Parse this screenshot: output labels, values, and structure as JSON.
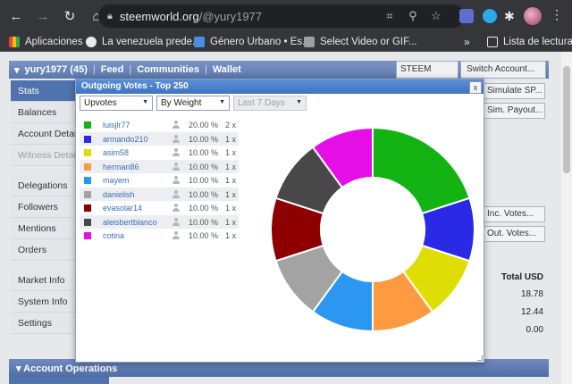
{
  "browser": {
    "url_host": "steemworld.org",
    "url_path": "/@yury1977",
    "bookmarks": [
      {
        "label": "Aplicaciones",
        "icon": "apps-grid-icon"
      },
      {
        "label": "La venezuela prede...",
        "icon": "globe-icon"
      },
      {
        "label": "Género Urbano • Es...",
        "icon": "download-icon"
      },
      {
        "label": "Select Video or GIF...",
        "icon": "video-icon"
      }
    ],
    "more_label": "»",
    "reading_list": "Lista de lectura"
  },
  "topbar": {
    "user": "yury1977 (45)",
    "links": [
      "Feed",
      "Communities",
      "Wallet"
    ],
    "separator": "|",
    "currency_select": "STEEM",
    "switch_account": "Switch Account..."
  },
  "sidebar": {
    "items": [
      {
        "label": "Stats",
        "state": "active"
      },
      {
        "label": "Balances",
        "state": "normal"
      },
      {
        "label": "Account Details",
        "state": "normal"
      },
      {
        "label": "Witness Details",
        "state": "disabled"
      },
      {
        "label": "Delegations",
        "state": "normal"
      },
      {
        "label": "Followers",
        "state": "normal"
      },
      {
        "label": "Mentions",
        "state": "normal"
      },
      {
        "label": "Orders",
        "state": "normal"
      },
      {
        "label": "Market Info",
        "state": "normal"
      },
      {
        "label": "System Info",
        "state": "normal"
      },
      {
        "label": "Settings",
        "state": "normal"
      }
    ]
  },
  "right_panel": {
    "simulate_sp": "Simulate SP...",
    "sim_payout": "Sim. Payout...",
    "inc_votes": "Inc. Votes...",
    "out_votes": "Out. Votes...",
    "total_usd_label": "Total USD",
    "values": [
      "18.78",
      "12.44",
      "0.00"
    ]
  },
  "account_operations": "Account Operations",
  "modal": {
    "title": "Outgoing Votes - Top 250",
    "close": "x",
    "filter_type": "Upvotes",
    "filter_sort": "By Weight",
    "filter_period": "Last 7 Days",
    "votes": [
      {
        "name": "luisjlr77",
        "pct": "20.00 %",
        "count": "2 x",
        "color": "#12b312"
      },
      {
        "name": "armando210",
        "pct": "10.00 %",
        "count": "1 x",
        "color": "#2a2ae6"
      },
      {
        "name": "asim58",
        "pct": "10.00 %",
        "count": "1 x",
        "color": "#dede05"
      },
      {
        "name": "herman86",
        "pct": "10.00 %",
        "count": "1 x",
        "color": "#ff9a40"
      },
      {
        "name": "mayem",
        "pct": "10.00 %",
        "count": "1 x",
        "color": "#2b97f1"
      },
      {
        "name": "danielish",
        "pct": "10.00 %",
        "count": "1 x",
        "color": "#a3a3a3"
      },
      {
        "name": "evasolar14",
        "pct": "10.00 %",
        "count": "1 x",
        "color": "#8e0000"
      },
      {
        "name": "aleisbertblanco",
        "pct": "10.00 %",
        "count": "1 x",
        "color": "#484848"
      },
      {
        "name": "cotina",
        "pct": "10.00 %",
        "count": "1 x",
        "color": "#e60ee6"
      }
    ]
  },
  "chart_data": {
    "type": "pie",
    "donut": true,
    "categories": [
      "luisjlr77",
      "armando210",
      "asim58",
      "herman86",
      "mayem",
      "danielish",
      "evasolar14",
      "aleisbertblanco",
      "cotina"
    ],
    "values": [
      20,
      10,
      10,
      10,
      10,
      10,
      10,
      10,
      10
    ],
    "colors": [
      "#12b312",
      "#2a2ae6",
      "#dede05",
      "#ff9a40",
      "#2b97f1",
      "#a3a3a3",
      "#8e0000",
      "#484848",
      "#e60ee6"
    ],
    "title": ""
  }
}
